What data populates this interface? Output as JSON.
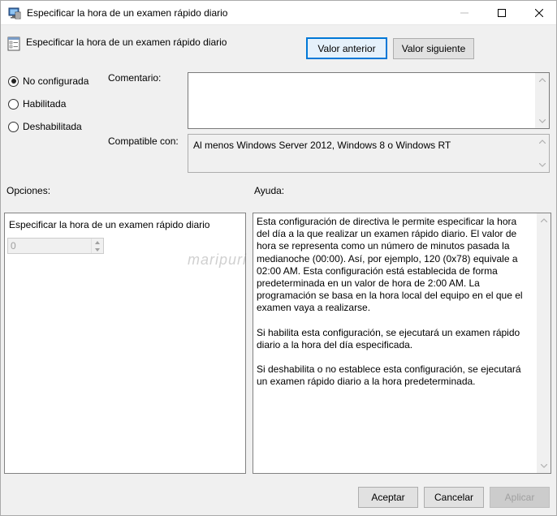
{
  "window": {
    "title": "Especificar la hora de un examen rápido diario"
  },
  "header": {
    "setting_title": "Especificar la hora de un examen rápido diario",
    "prev_button": "Valor anterior",
    "next_button": "Valor siguiente"
  },
  "state": {
    "options": [
      {
        "label": "No configurada",
        "checked": true
      },
      {
        "label": "Habilitada",
        "checked": false
      },
      {
        "label": "Deshabilitada",
        "checked": false
      }
    ]
  },
  "comment": {
    "label": "Comentario:",
    "value": ""
  },
  "supported": {
    "label": "Compatible con:",
    "value": "Al menos Windows Server 2012, Windows 8 o Windows RT"
  },
  "options_panel": {
    "label": "Opciones:",
    "field_label": "Especificar la hora de un examen rápido diario",
    "field_value": "0"
  },
  "help_panel": {
    "label": "Ayuda:",
    "paragraphs": [
      "Esta configuración de directiva le permite especificar la hora del día a la que realizar un examen rápido diario. El valor de hora se representa como un número de minutos pasada la medianoche (00:00).  Así, por ejemplo, 120 (0x78) equivale a 02:00 AM. Esta configuración está establecida de forma predeterminada en un valor de hora de 2:00 AM. La programación se basa en la hora local del equipo en el que el examen vaya a realizarse.",
      "Si habilita esta configuración, se ejecutará un examen rápido diario a la hora del día especificada.",
      "Si deshabilita o no establece esta configuración, se ejecutará un examen rápido diario a la hora predeterminada."
    ]
  },
  "footer": {
    "accept": "Aceptar",
    "cancel": "Cancelar",
    "apply": "Aplicar"
  },
  "watermark": "maripuri"
}
